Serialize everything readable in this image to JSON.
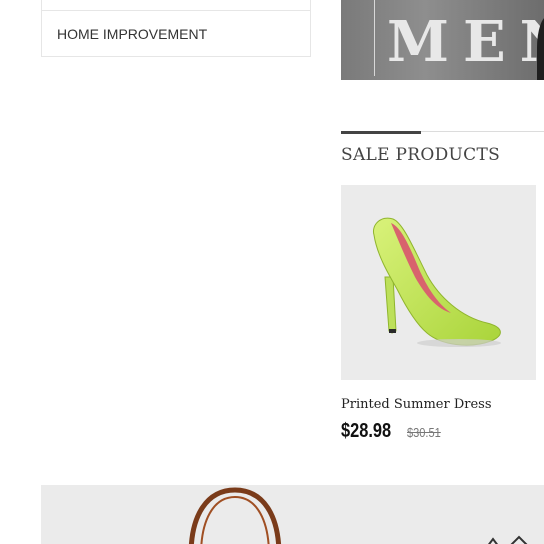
{
  "sidebar": {
    "items": [
      {
        "label": ""
      },
      {
        "label": "HOME IMPROVEMENT"
      }
    ]
  },
  "men_banner": {
    "text": "MEN"
  },
  "sale_section": {
    "title": "SALE PRODUCTS",
    "product": {
      "name": "Printed Summer Dress",
      "price": "$28.98",
      "old_price": "$30.51",
      "image_icon": "green-high-heel-shoe"
    }
  },
  "bottom_banner": {
    "image_icon": "brown-handbag"
  }
}
